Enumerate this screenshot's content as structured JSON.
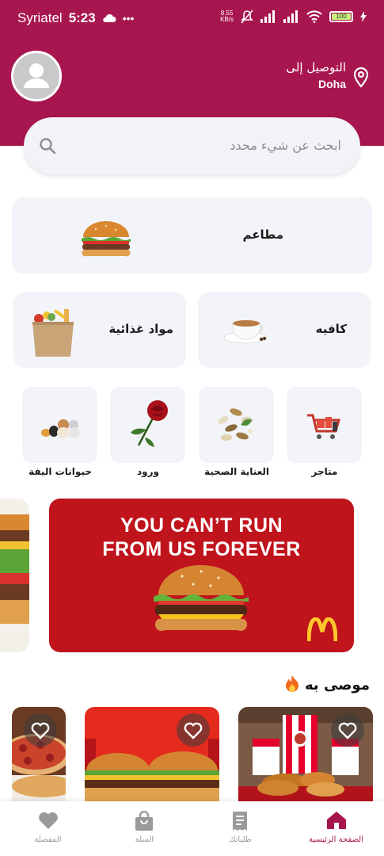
{
  "status_bar": {
    "carrier": "Syriatel",
    "time": "5:23",
    "net_speed": "8.55",
    "net_unit": "KB/s",
    "battery": "100"
  },
  "header": {
    "deliver_label": "التوصيل إلى",
    "city": "Doha"
  },
  "search": {
    "placeholder": "ابحث عن شيء محدد"
  },
  "categories": {
    "restaurants": "مطاعم",
    "cafe": "كافيه",
    "groceries": "مواد غذائية",
    "stores": "متاجر",
    "health_care": "العناية الصحية",
    "flowers": "ورود",
    "pets": "حيوانات اليفة"
  },
  "banner": {
    "line1": "YOU CAN’T RUN",
    "line2": "FROM US FOREVER"
  },
  "recommended": {
    "title": "موصى به"
  },
  "nav": {
    "home": "الصفحة الرئيسية",
    "orders": "طلباتك",
    "cart": "السلة",
    "favorites": "المفضلة"
  },
  "colors": {
    "brand": "#a8164f",
    "tile_bg": "#f2f4f9",
    "banner_red": "#c0141c"
  }
}
